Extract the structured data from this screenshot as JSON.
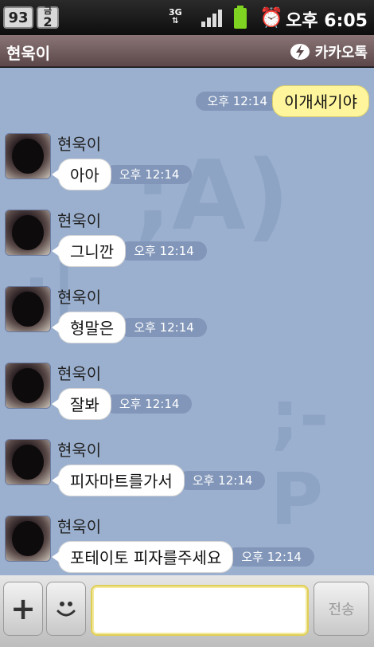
{
  "status_bar": {
    "battery_level_text": "93",
    "day_line1": "금",
    "day_line2": "2",
    "network": "3G",
    "time": "오후 6:05"
  },
  "header": {
    "title": "현욱이",
    "brand": "카카오톡"
  },
  "watermarks": [
    ";A)",
    ";-P",
    ":|"
  ],
  "sent_messages": [
    {
      "text": "이개새기야",
      "time": "오후 12:14"
    }
  ],
  "received_messages": [
    {
      "sender": "현욱이",
      "text": "아아",
      "time": "오후 12:14"
    },
    {
      "sender": "현욱이",
      "text": "그니깐",
      "time": "오후 12:14"
    },
    {
      "sender": "현욱이",
      "text": "형말은",
      "time": "오후 12:14"
    },
    {
      "sender": "현욱이",
      "text": "잘봐",
      "time": "오후 12:14"
    },
    {
      "sender": "현욱이",
      "text": "피자마트를가서",
      "time": "오후 12:14"
    },
    {
      "sender": "현욱이",
      "text": "포테이토 피자를주세요",
      "time": "오후 12:14"
    }
  ],
  "input_bar": {
    "plus_label": "+",
    "send_label": "전송",
    "input_value": ""
  },
  "colors": {
    "chat_background": "#9bb0cf",
    "my_bubble": "#fef59d",
    "their_bubble": "#ffffff",
    "title_bar": "#6b5557"
  }
}
